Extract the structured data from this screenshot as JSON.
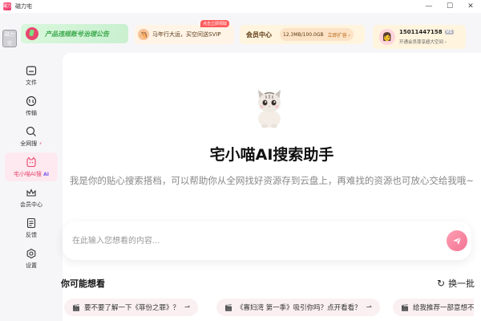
{
  "window": {
    "app_icon_text": "磁力",
    "title": "磁力宅",
    "controls": {
      "minimize": "—",
      "maximize": "☐",
      "close": "✕"
    }
  },
  "sidebar": {
    "logo_text": "磁力宅",
    "items": [
      {
        "label": "文件",
        "icon": "folder-icon"
      },
      {
        "label": "传输",
        "icon": "transfer-icon"
      },
      {
        "label": "全网搜",
        "icon": "search-icon",
        "tag": "⚡"
      },
      {
        "label": "宅小喵AI搜",
        "icon": "cat-icon",
        "tag": "AI",
        "active": true
      },
      {
        "label": "会员中心",
        "icon": "crown-icon"
      },
      {
        "label": "反馈",
        "icon": "feedback-icon"
      },
      {
        "label": "设置",
        "icon": "gear-icon"
      }
    ]
  },
  "topbar": {
    "notice": {
      "text": "产品违规账号治理公告"
    },
    "promo": {
      "badge": "点击立即领取",
      "text": "马年行大运，买空间送SVIP"
    },
    "member": {
      "title": "会员中心",
      "storage": "12.3MB/100.0GB",
      "expand_label": "立即扩容 ›"
    },
    "user": {
      "phone": "15011447158",
      "level": "V1",
      "subtitle": "开通会员尊享超大空间 ›"
    }
  },
  "main": {
    "title": "宅小喵AI搜索助手",
    "description": "我是你的贴心搜索搭档，可以帮助你从全网找好资源存到云盘上，再难找的资源也可放心交给我哦~",
    "search": {
      "placeholder": "在此输入您想看的内容...",
      "value": ""
    },
    "suggestions_title": "你可能想看",
    "refresh_label": "换一批",
    "suggestions": [
      "要不要了解一下《菲份之罪》？",
      "《寡妇湾 第一季》吸引你吗？点开看看？",
      "给我推荐一部意想不"
    ]
  },
  "colors": {
    "accent": "#e8466f",
    "notice_green": "#39a84a",
    "member_brown": "#5c3a12"
  }
}
